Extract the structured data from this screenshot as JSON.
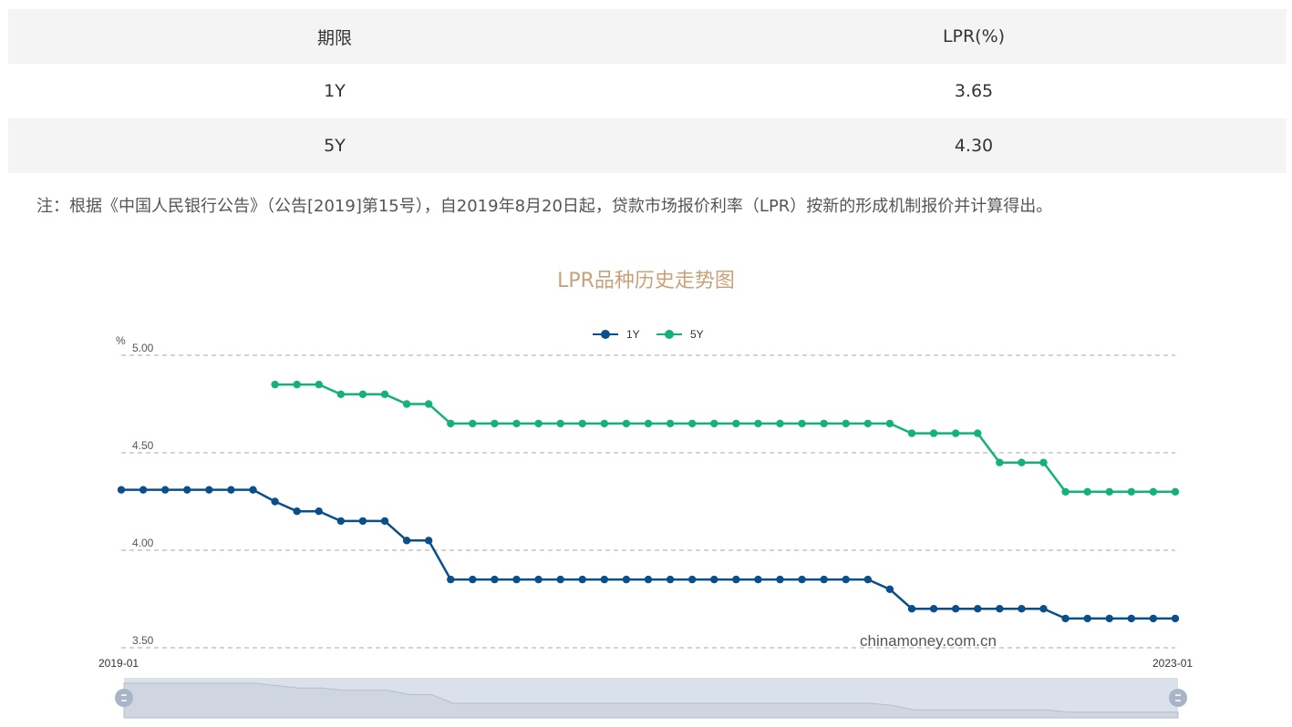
{
  "table": {
    "header": {
      "term": "期限",
      "rate": "LPR(%)"
    },
    "rows": [
      {
        "term": "1Y",
        "rate": "3.65"
      },
      {
        "term": "5Y",
        "rate": "4.30"
      }
    ]
  },
  "note": "注：根据《中国人民银行公告》（公告[2019]第15号），自2019年8月20日起，贷款市场报价利率（LPR）按新的形成机制报价并计算得出。",
  "chart": {
    "title": "LPR品种历史走势图",
    "watermark": "chinamoney.com.cn"
  },
  "chart_data": {
    "type": "line",
    "title": "LPR品种历史走势图",
    "ylabel": "%",
    "ylim": [
      3.5,
      5.0
    ],
    "yticks": [
      "5.00",
      "4.50",
      "4.00",
      "3.50"
    ],
    "xrange_labels": [
      "2019-01",
      "2023-01"
    ],
    "grid": true,
    "legend": "top-center",
    "colors": {
      "1Y": "#0b4f8a",
      "5Y": "#14b07d",
      "grid": "#aaaaaa",
      "slider_fill": "#dbe1ea",
      "slider_handle": "#a8b5c8"
    },
    "series": [
      {
        "name": "1Y",
        "values": [
          4.31,
          4.31,
          4.31,
          4.31,
          4.31,
          4.31,
          4.31,
          4.25,
          4.2,
          4.2,
          4.15,
          4.15,
          4.15,
          4.05,
          4.05,
          3.85,
          3.85,
          3.85,
          3.85,
          3.85,
          3.85,
          3.85,
          3.85,
          3.85,
          3.85,
          3.85,
          3.85,
          3.85,
          3.85,
          3.85,
          3.85,
          3.85,
          3.85,
          3.85,
          3.85,
          3.8,
          3.7,
          3.7,
          3.7,
          3.7,
          3.7,
          3.7,
          3.7,
          3.65,
          3.65,
          3.65,
          3.65,
          3.65,
          3.65
        ]
      },
      {
        "name": "5Y",
        "values": [
          null,
          null,
          null,
          null,
          null,
          null,
          null,
          4.85,
          4.85,
          4.85,
          4.8,
          4.8,
          4.8,
          4.75,
          4.75,
          4.65,
          4.65,
          4.65,
          4.65,
          4.65,
          4.65,
          4.65,
          4.65,
          4.65,
          4.65,
          4.65,
          4.65,
          4.65,
          4.65,
          4.65,
          4.65,
          4.65,
          4.65,
          4.65,
          4.65,
          4.65,
          4.6,
          4.6,
          4.6,
          4.6,
          4.45,
          4.45,
          4.45,
          4.3,
          4.3,
          4.3,
          4.3,
          4.3,
          4.3
        ]
      }
    ]
  }
}
